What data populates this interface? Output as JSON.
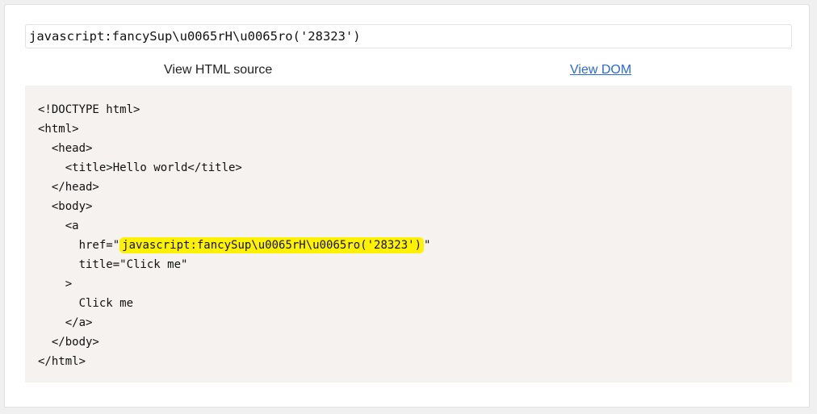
{
  "url_input": {
    "value": "javascript:fancySup\\u0065rH\\u0065ro('28323')"
  },
  "tabs": {
    "source_label": "View HTML source",
    "dom_label": "View DOM"
  },
  "source": {
    "lines": [
      "<!DOCTYPE html>",
      "<html>",
      "  <head>",
      "    <title>Hello world</title>",
      "  </head>",
      "  <body>",
      "    <a",
      "      href=\"",
      "      title=\"Click me\"",
      "    >",
      "      Click me",
      "    </a>",
      "  </body>",
      "</html>"
    ],
    "href_value": "javascript:fancySup\\u0065rH\\u0065ro('28323')",
    "href_close": "\"",
    "highlight_color": "#fff200"
  }
}
